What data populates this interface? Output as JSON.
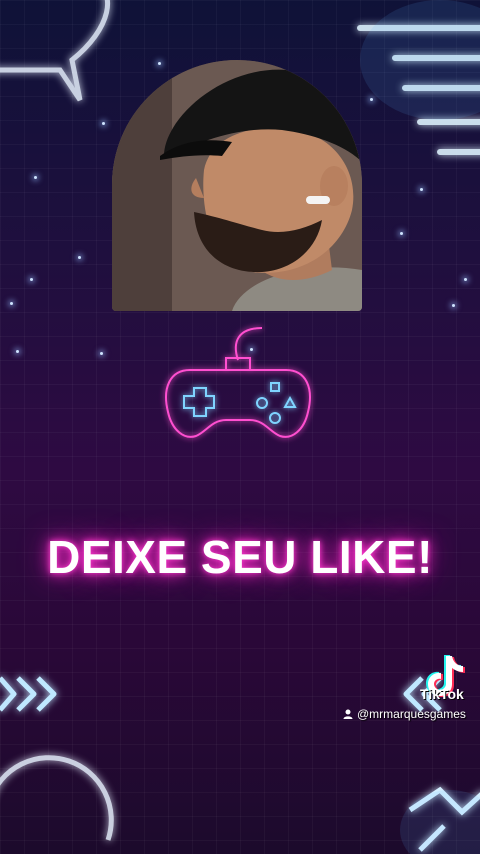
{
  "headline": "DEIXE SEU LIKE!",
  "watermark": {
    "brand": "TikTok",
    "handle": "@mrmarquesgames"
  },
  "colors": {
    "neon_pink": "#ff2ac8",
    "neon_blue": "#8fd8ff",
    "background_top": "#0f1238",
    "background_bottom": "#2e0a42"
  },
  "icons": [
    "game-controller-icon",
    "arrows-right-icon",
    "arrows-left-icon",
    "tiktok-logo-icon",
    "user-icon"
  ]
}
